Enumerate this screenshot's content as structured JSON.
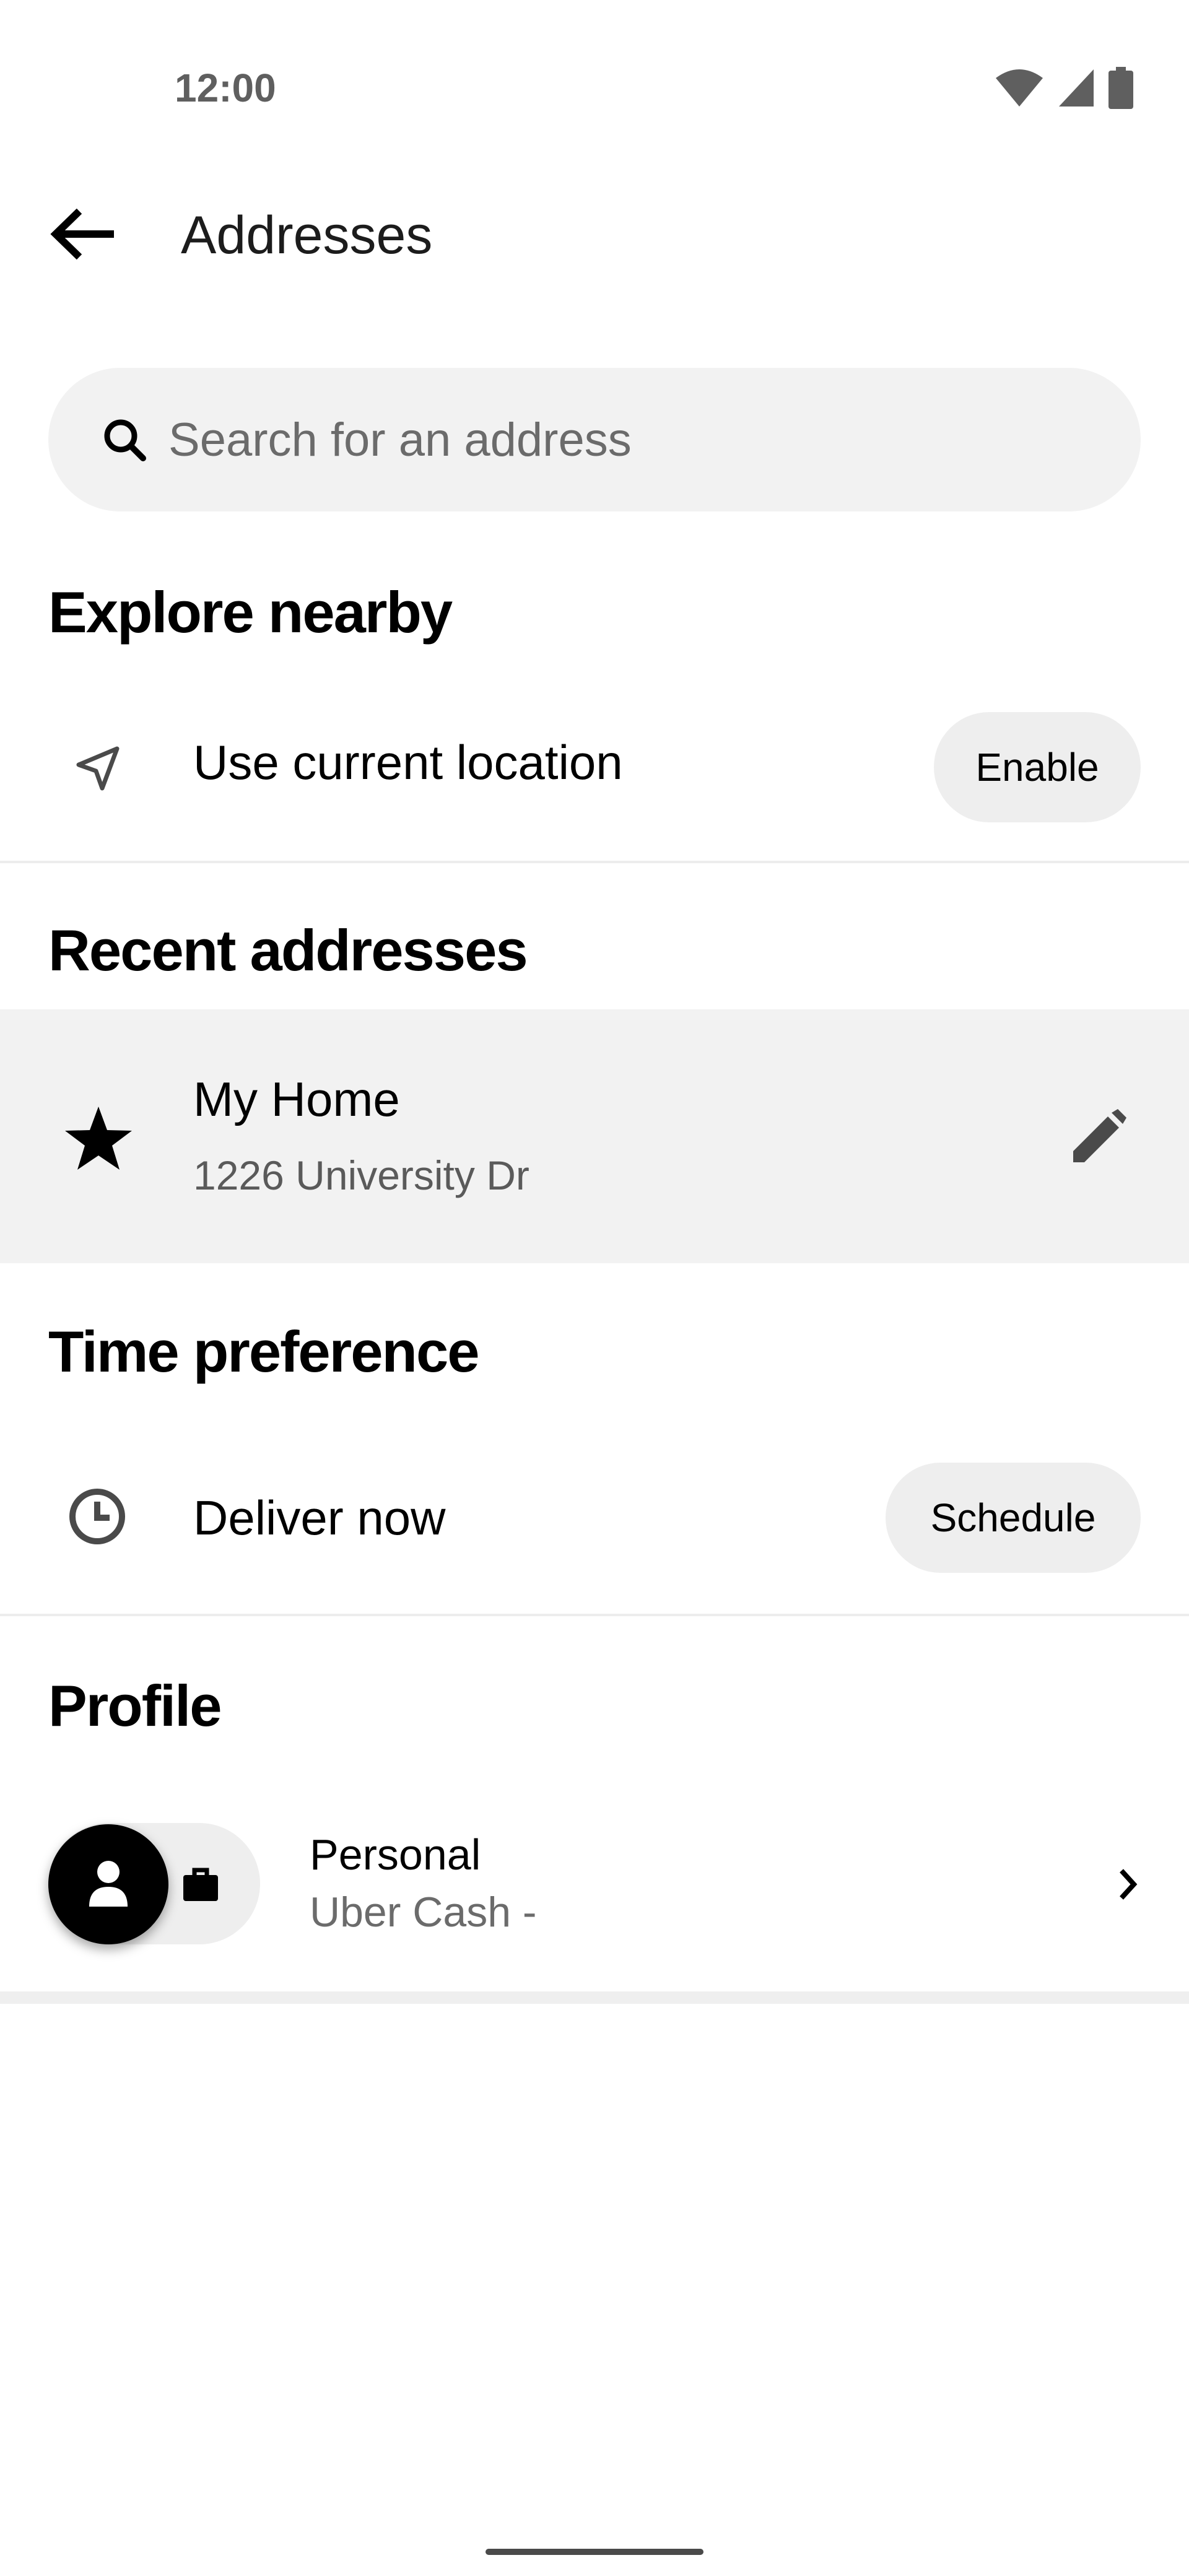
{
  "status_bar": {
    "time": "12:00",
    "icons": [
      "wifi-icon",
      "signal-icon",
      "battery-icon"
    ]
  },
  "header": {
    "back_icon": "arrow-left-icon",
    "title": "Addresses"
  },
  "search": {
    "icon": "search-icon",
    "placeholder": "Search for an address"
  },
  "explore_nearby": {
    "heading": "Explore nearby",
    "location_icon": "navigation-arrow-icon",
    "location_label": "Use current location",
    "enable_label": "Enable"
  },
  "recent_addresses": {
    "heading": "Recent addresses",
    "items": [
      {
        "icon": "star-icon",
        "name": "My Home",
        "address": "1226 University Dr",
        "edit_icon": "pencil-icon"
      }
    ]
  },
  "time_preference": {
    "heading": "Time preference",
    "clock_icon": "clock-icon",
    "label": "Deliver now",
    "schedule_label": "Schedule"
  },
  "profile": {
    "heading": "Profile",
    "avatar_icon": "person-icon",
    "alt_icon": "briefcase-icon",
    "name": "Personal",
    "subtitle": "Uber Cash -",
    "chevron_icon": "chevron-right-icon"
  },
  "colors": {
    "background": "#ffffff",
    "surface": "#f2f2f2",
    "pill": "#eeeeee",
    "text_primary": "#000000",
    "text_secondary": "#6b6b6b"
  }
}
